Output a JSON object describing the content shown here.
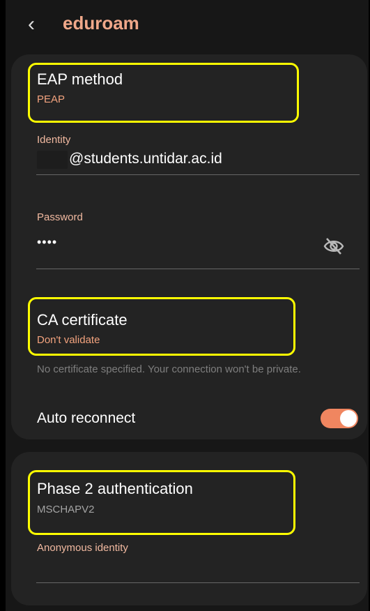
{
  "header": {
    "back_icon": "chevron-left-icon",
    "title": "eduroam"
  },
  "eap": {
    "title": "EAP method",
    "value": "PEAP"
  },
  "identity": {
    "label": "Identity",
    "value": "@students.untidar.ac.id"
  },
  "password": {
    "label": "Password",
    "value": "••••",
    "visibility_icon": "eye-off-icon"
  },
  "ca": {
    "title": "CA certificate",
    "value": "Don't validate",
    "hint": "No certificate specified. Your connection won't be private."
  },
  "auto_reconnect": {
    "label": "Auto reconnect",
    "enabled": true
  },
  "phase2": {
    "title": "Phase 2 authentication",
    "value": "MSCHAPV2"
  },
  "anonymous": {
    "label": "Anonymous identity",
    "value": ""
  },
  "colors": {
    "accent": "#f08660",
    "highlight": "#ffff00",
    "card": "#232323",
    "background": "#171717"
  }
}
